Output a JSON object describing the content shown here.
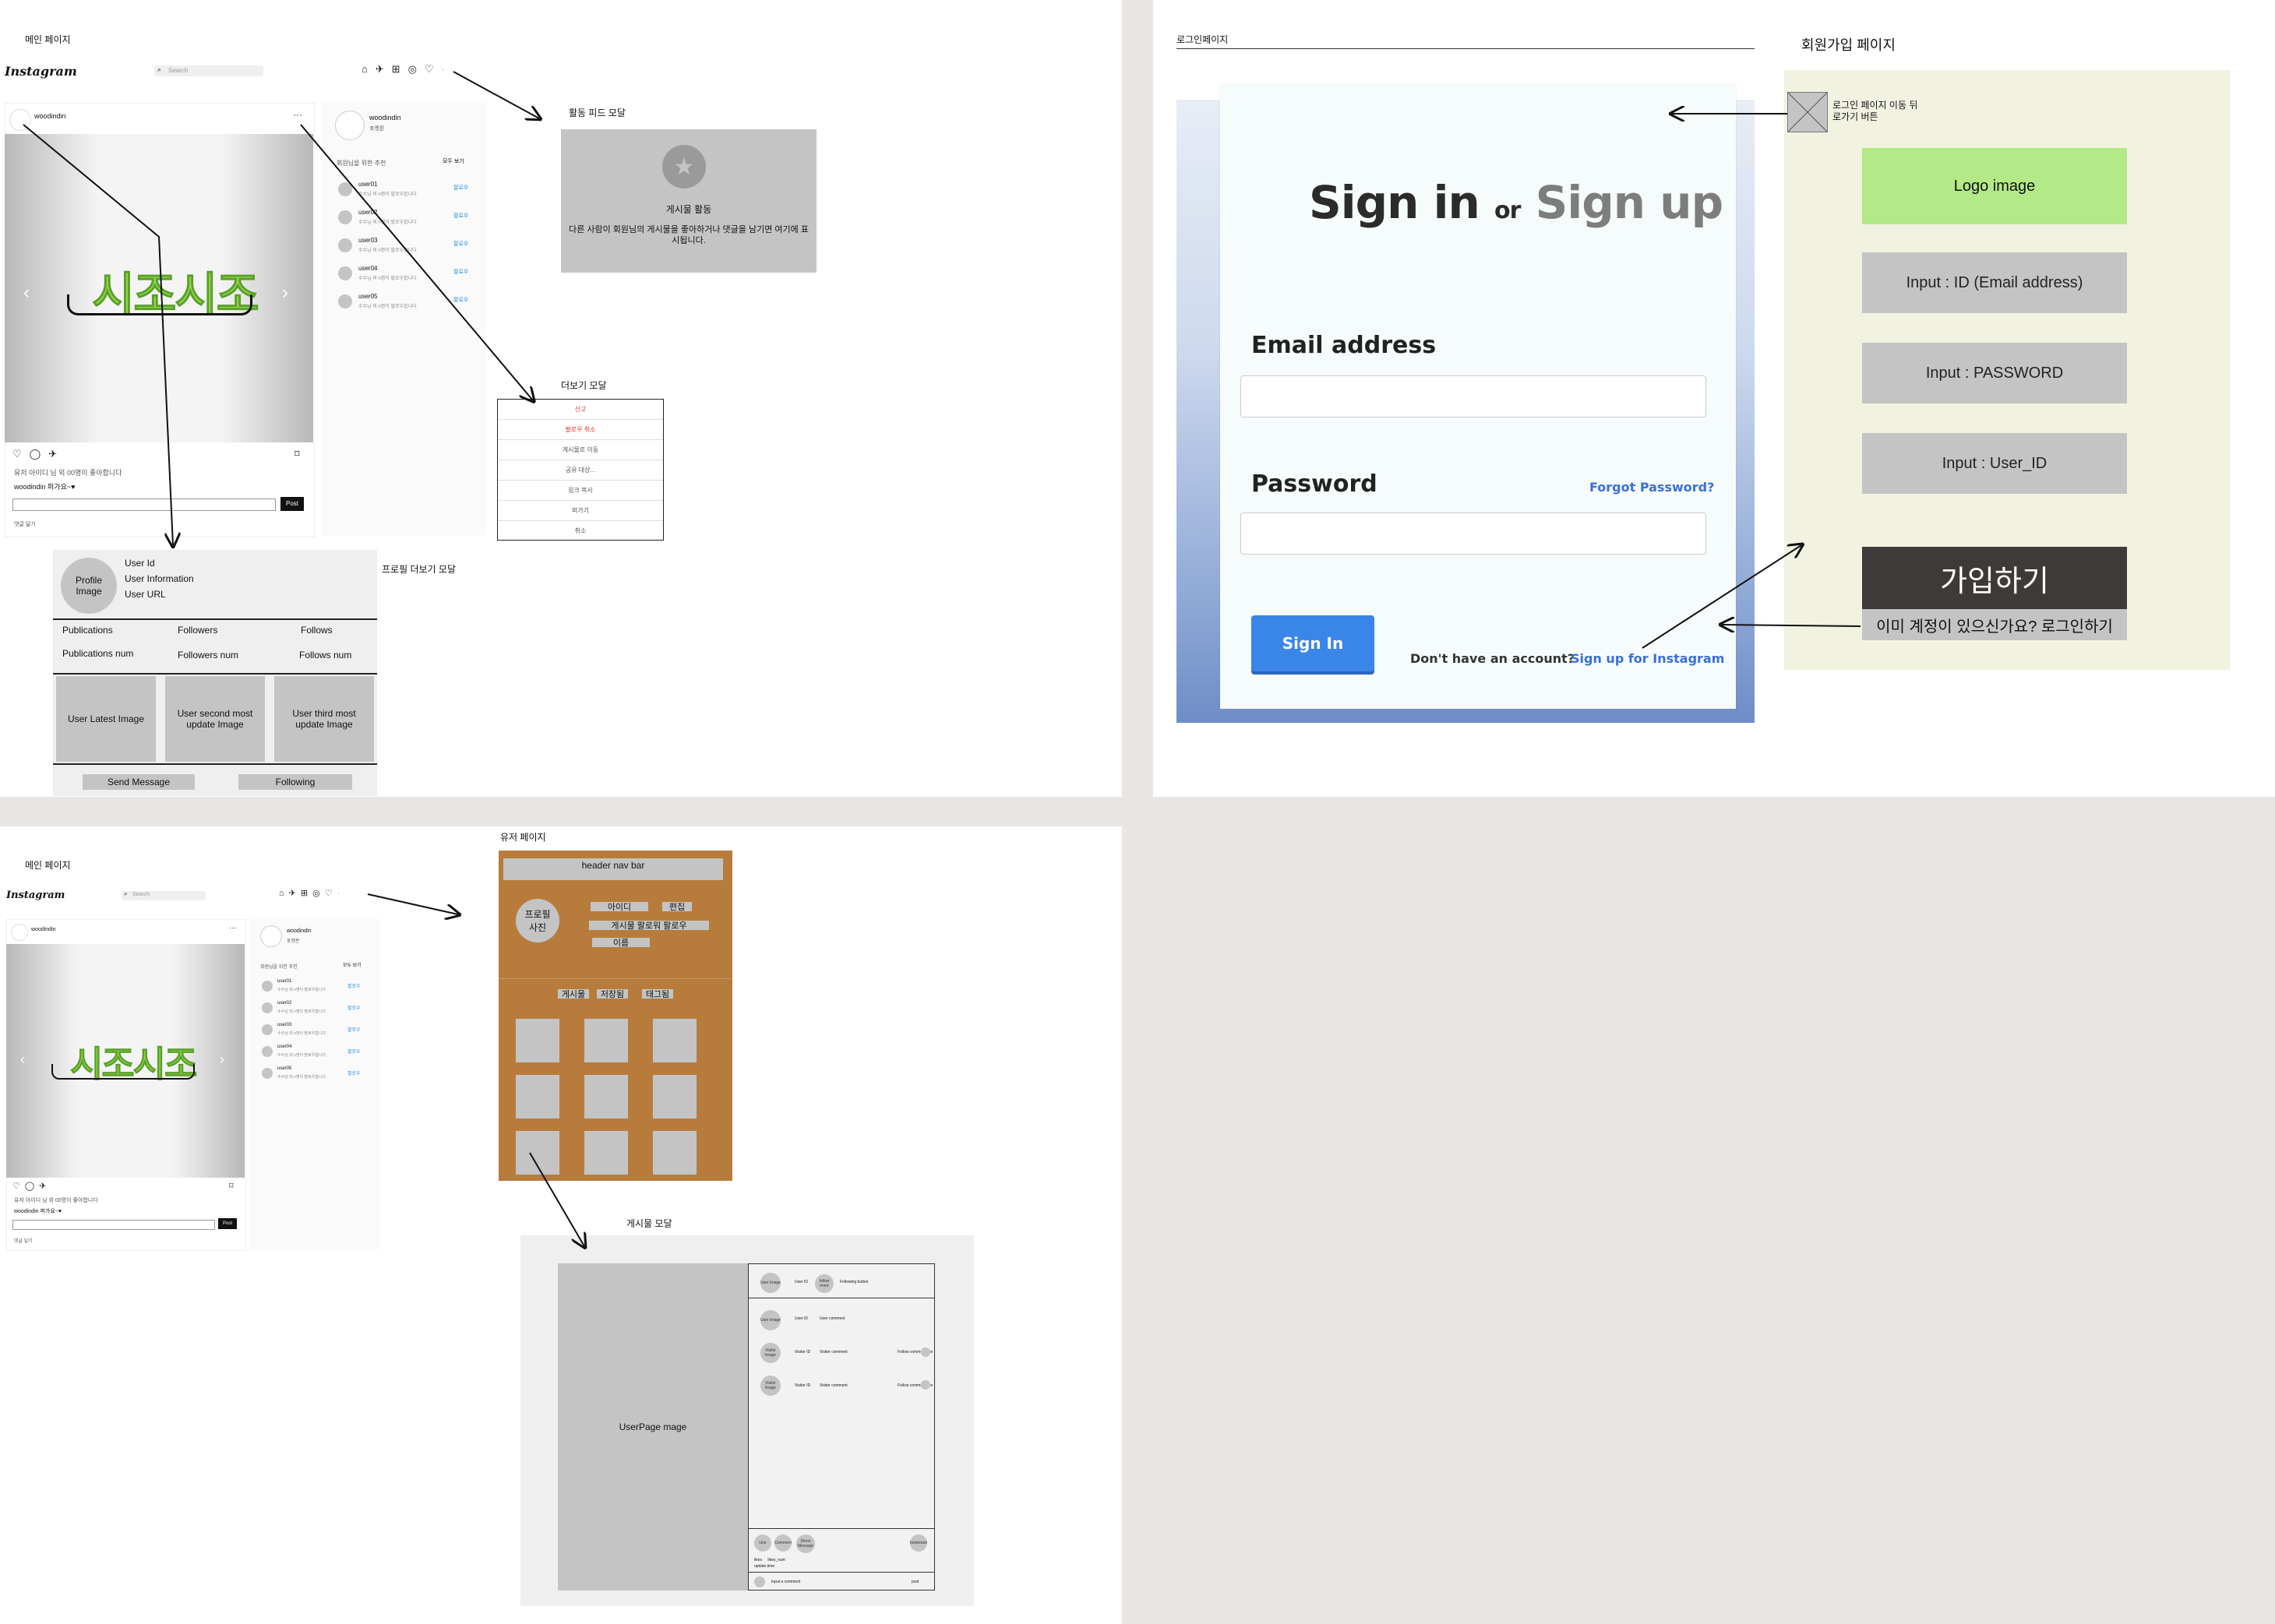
{
  "labels": {
    "main_page_1": "메인 페이지",
    "main_page_2": "메인 페이지",
    "activity_modal": "활동 피드 모달",
    "more_modal": "더보기 모달",
    "profile_more_modal": "프로필 더보기 모달",
    "login_page": "로그인페이지",
    "signup_page": "회원가입 페이지",
    "user_page": "유저 페이지",
    "post_modal": "게시물 모달"
  },
  "instagram": {
    "logo": "Instagram",
    "search_placeholder": "Search",
    "post_user": "woodindin",
    "post_likes": "유저 아이디 님 외 00명이 좋아합니다",
    "post_caption": "woodindin 퍼가요~♥",
    "post_button": "Post",
    "comment_hint": "댓글 달기",
    "sidebar_user": "woodindin",
    "sidebar_sub": "포켓몬",
    "suggest_title": "회원님을 위한 추천",
    "see_all": "모두 보기",
    "suggest_sub": "수수님 외 n명이 팔로우합니다",
    "follow": "팔로우",
    "suggestions": [
      "user01",
      "user02",
      "user03",
      "user04",
      "user05"
    ],
    "pic_text": "시조시조"
  },
  "activity_modal": {
    "title": "게시물 활동",
    "desc": "다른 사람이 회원님의 게시물을 좋아하거나 댓글을 남기면 여기에 표시됩니다."
  },
  "more_modal": {
    "items": [
      "신고",
      "팔로우 취소",
      "게시물로 이동",
      "공유 대상...",
      "링크 복사",
      "퍼가기",
      "취소"
    ]
  },
  "profile_modal": {
    "profile_image": "Profile Image",
    "user_id": "User Id",
    "user_info": "User Information",
    "user_url": "User URL",
    "stat_labels": [
      "Publications",
      "Followers",
      "Follows"
    ],
    "stat_nums": [
      "Publications num",
      "Followers num",
      "Follows num"
    ],
    "images": [
      "User Latest Image",
      "User second most update Image",
      "User third most update Image"
    ],
    "send_message": "Send Message",
    "following": "Following"
  },
  "login": {
    "title_signin": "Sign in",
    "title_or": "or",
    "title_signup": "Sign up",
    "email_label": "Email address",
    "password_label": "Password",
    "forgot": "Forgot Password?",
    "signin_button": "Sign In",
    "no_account": "Don't have an account?",
    "signup_link": "Sign up for Instagram"
  },
  "signup": {
    "back_label": "로그인 페이지 이동 뒤로가기 버튼",
    "logo": "Logo image",
    "input_id": "Input : ID (Email address)",
    "input_pw": "Input : PASSWORD",
    "input_userid": "Input : User_ID",
    "join": "가입하기",
    "have_account": "이미 계정이 있으신가요? 로그인하기"
  },
  "user_page": {
    "header": "header nav bar",
    "profile_photo": "프로필 사진",
    "id": "아이디",
    "edit": "편집",
    "stats": "게시물 팔로워 팔로우",
    "name": "이름",
    "tabs": [
      "게시물",
      "저장됨",
      "태그됨"
    ]
  },
  "post_modal": {
    "image": "UserPage mage",
    "user_image": "User Image",
    "user_id": "User ID",
    "more": "follow more",
    "follow_state": "Following button",
    "comment_user": "User ID",
    "comment": "User comment",
    "visitor_image": "Visitor Image",
    "visitor_id": "Visitor ID",
    "visitor_comment": "Visitor comment",
    "visitor_like": "Follow comment like",
    "actions": [
      "Like",
      "Comment",
      "Direct Message"
    ],
    "bookmark": "bookmark",
    "likes": "likes",
    "likes_count": "likes_num",
    "update": "update time",
    "comment_input": "Input a comment",
    "post": "post"
  }
}
